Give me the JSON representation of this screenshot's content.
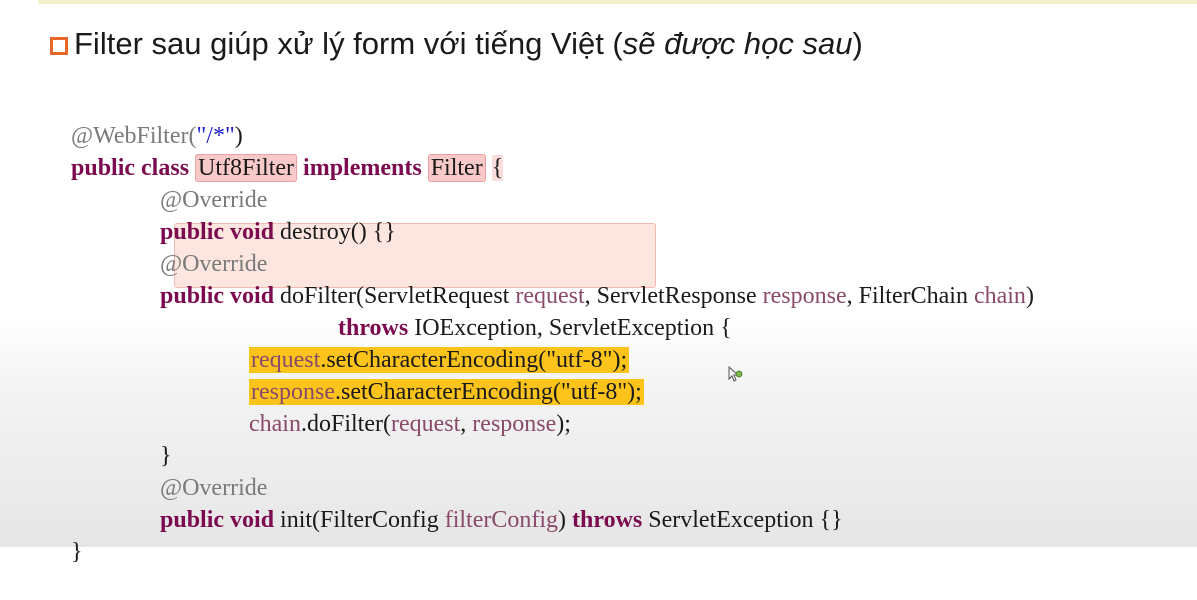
{
  "heading": {
    "text": "Filter sau giúp xử lý form với tiếng Việt (",
    "italic": "sẽ được học sau",
    "close": ")"
  },
  "code": {
    "l1_ann": "@WebFilter(",
    "l1_str": "\"/*\"",
    "l1_end": ")",
    "l2_kw": "public class",
    "l2_type": "Utf8Filter",
    "l2_kw2": "implements",
    "l2_type2": "Filter",
    "l2_brace": "{",
    "l3": "@Override",
    "l4_kw": "public void",
    "l4_rest": "destroy() {}",
    "l5": "@Override",
    "l6_kw": "public void",
    "l6_a": "doFilter(ServletRequest",
    "l6_v1": "request",
    "l6_b": ", ServletResponse",
    "l6_v2": "response",
    "l6_c": ", FilterChain",
    "l6_v3": "chain",
    "l6_d": ")",
    "l7_kw": "throws",
    "l7_rest": "IOException, ServletException {",
    "l8_var": "request",
    "l8_call": ".setCharacterEncoding(",
    "l8_str": "\"utf-8\"",
    "l8_end": ");",
    "l9_var": "response",
    "l9_call": ".setCharacterEncoding(",
    "l9_str": "\"utf-8\"",
    "l9_end": ");",
    "l10_var": "chain",
    "l10_call": ".doFilter(",
    "l10_v1": "request",
    "l10_sep": ", ",
    "l10_v2": "response",
    "l10_end": ");",
    "l11": "}",
    "l12": "@Override",
    "l13_kw": "public void",
    "l13_a": "init(FilterConfig",
    "l13_v": "filterConfig",
    "l13_b": ")",
    "l13_kw2": "throws",
    "l13_c": "ServletException {}",
    "l14": "}"
  },
  "colors": {
    "bullet": "#e8662c",
    "keyword": "#7b0a4f",
    "annotation": "#7a7a7a",
    "string": "#1c1cc8",
    "highlight_yellow": "#fcc31a",
    "highlight_pink": "#f8c9c9"
  },
  "icons": {
    "bullet": "hollow-square-bullet-icon",
    "cursor": "mouse-cursor-icon"
  }
}
